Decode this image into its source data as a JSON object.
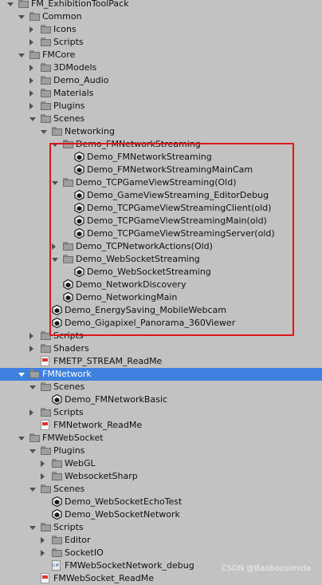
{
  "tree": [
    {
      "label": "FM_ExhibitionToolPack",
      "icon": "folder-icon",
      "depth": 0,
      "arrow": "open"
    },
    {
      "label": "Common",
      "icon": "folder-icon",
      "depth": 1,
      "arrow": "open"
    },
    {
      "label": "Icons",
      "icon": "folder-icon",
      "depth": 2,
      "arrow": "closed"
    },
    {
      "label": "Scripts",
      "icon": "folder-icon",
      "depth": 2,
      "arrow": "closed"
    },
    {
      "label": "FMCore",
      "icon": "folder-icon",
      "depth": 1,
      "arrow": "open"
    },
    {
      "label": "3DModels",
      "icon": "folder-icon",
      "depth": 2,
      "arrow": "closed"
    },
    {
      "label": "Demo_Audio",
      "icon": "folder-icon",
      "depth": 2,
      "arrow": "closed"
    },
    {
      "label": "Materials",
      "icon": "folder-icon",
      "depth": 2,
      "arrow": "closed"
    },
    {
      "label": "Plugins",
      "icon": "folder-icon",
      "depth": 2,
      "arrow": "closed"
    },
    {
      "label": "Scenes",
      "icon": "folder-icon",
      "depth": 2,
      "arrow": "open"
    },
    {
      "label": "Networking",
      "icon": "folder-icon",
      "depth": 3,
      "arrow": "open"
    },
    {
      "label": "Demo_FMNetworkStreaming",
      "icon": "folder-icon",
      "depth": 4,
      "arrow": "open"
    },
    {
      "label": "Demo_FMNetworkStreaming",
      "icon": "unity-scene-icon",
      "depth": 5,
      "arrow": "none"
    },
    {
      "label": "Demo_FMNetworkStreamingMainCam",
      "icon": "unity-scene-icon",
      "depth": 5,
      "arrow": "none"
    },
    {
      "label": "Demo_TCPGameViewStreaming(Old)",
      "icon": "folder-icon",
      "depth": 4,
      "arrow": "open"
    },
    {
      "label": "Demo_GameViewStreaming_EditorDebug",
      "icon": "unity-scene-icon",
      "depth": 5,
      "arrow": "none"
    },
    {
      "label": "Demo_TCPGameViewStreamingClient(old)",
      "icon": "unity-scene-icon",
      "depth": 5,
      "arrow": "none"
    },
    {
      "label": "Demo_TCPGameViewStreamingMain(old)",
      "icon": "unity-scene-icon",
      "depth": 5,
      "arrow": "none"
    },
    {
      "label": "Demo_TCPGameViewStreamingServer(old)",
      "icon": "unity-scene-icon",
      "depth": 5,
      "arrow": "none"
    },
    {
      "label": "Demo_TCPNetworkActions(Old)",
      "icon": "folder-icon",
      "depth": 4,
      "arrow": "closed"
    },
    {
      "label": "Demo_WebSocketStreaming",
      "icon": "folder-icon",
      "depth": 4,
      "arrow": "open"
    },
    {
      "label": "Demo_WebSocketStreaming",
      "icon": "unity-scene-icon",
      "depth": 5,
      "arrow": "none"
    },
    {
      "label": "Demo_NetworkDiscovery",
      "icon": "unity-scene-icon",
      "depth": 4,
      "arrow": "none"
    },
    {
      "label": "Demo_NetworkingMain",
      "icon": "unity-scene-icon",
      "depth": 4,
      "arrow": "none"
    },
    {
      "label": "Demo_EnergySaving_MobileWebcam",
      "icon": "unity-scene-icon",
      "depth": 3,
      "arrow": "none"
    },
    {
      "label": "Demo_Gigapixel_Panorama_360Viewer",
      "icon": "unity-scene-icon",
      "depth": 3,
      "arrow": "none"
    },
    {
      "label": "Scripts",
      "icon": "folder-icon",
      "depth": 2,
      "arrow": "closed"
    },
    {
      "label": "Shaders",
      "icon": "folder-icon",
      "depth": 2,
      "arrow": "closed"
    },
    {
      "label": "FMETP_STREAM_ReadMe",
      "icon": "text-asset-icon",
      "depth": 2,
      "arrow": "none"
    },
    {
      "label": "FMNetwork",
      "icon": "folder-icon",
      "depth": 1,
      "arrow": "open",
      "selected": true
    },
    {
      "label": "Scenes",
      "icon": "folder-icon",
      "depth": 2,
      "arrow": "open"
    },
    {
      "label": "Demo_FMNetworkBasic",
      "icon": "unity-scene-icon",
      "depth": 3,
      "arrow": "none"
    },
    {
      "label": "Scripts",
      "icon": "folder-icon",
      "depth": 2,
      "arrow": "closed"
    },
    {
      "label": "FMNetwork_ReadMe",
      "icon": "text-asset-icon",
      "depth": 2,
      "arrow": "none"
    },
    {
      "label": "FMWebSocket",
      "icon": "folder-icon",
      "depth": 1,
      "arrow": "open"
    },
    {
      "label": "Plugins",
      "icon": "folder-icon",
      "depth": 2,
      "arrow": "open"
    },
    {
      "label": "WebGL",
      "icon": "folder-icon",
      "depth": 3,
      "arrow": "closed"
    },
    {
      "label": "WebsocketSharp",
      "icon": "folder-icon",
      "depth": 3,
      "arrow": "closed"
    },
    {
      "label": "Scenes",
      "icon": "folder-icon",
      "depth": 2,
      "arrow": "open"
    },
    {
      "label": "Demo_WebSocketEchoTest",
      "icon": "unity-scene-icon",
      "depth": 3,
      "arrow": "none"
    },
    {
      "label": "Demo_WebSocketNetwork",
      "icon": "unity-scene-icon",
      "depth": 3,
      "arrow": "none"
    },
    {
      "label": "Scripts",
      "icon": "folder-icon",
      "depth": 2,
      "arrow": "open"
    },
    {
      "label": "Editor",
      "icon": "folder-icon",
      "depth": 3,
      "arrow": "closed"
    },
    {
      "label": "SocketIO",
      "icon": "folder-icon",
      "depth": 3,
      "arrow": "closed"
    },
    {
      "label": "FMWebSocketNetwork_debug",
      "icon": "csharp-script-icon",
      "depth": 3,
      "arrow": "none"
    },
    {
      "label": "FMWebSocket_ReadMe",
      "icon": "text-asset-icon",
      "depth": 2,
      "arrow": "none"
    }
  ],
  "watermark": "CSDN @Baobaosimida",
  "colors": {
    "background": "#c2c2c2",
    "selection": "#3d80df",
    "highlight_box": "#e0141c"
  }
}
